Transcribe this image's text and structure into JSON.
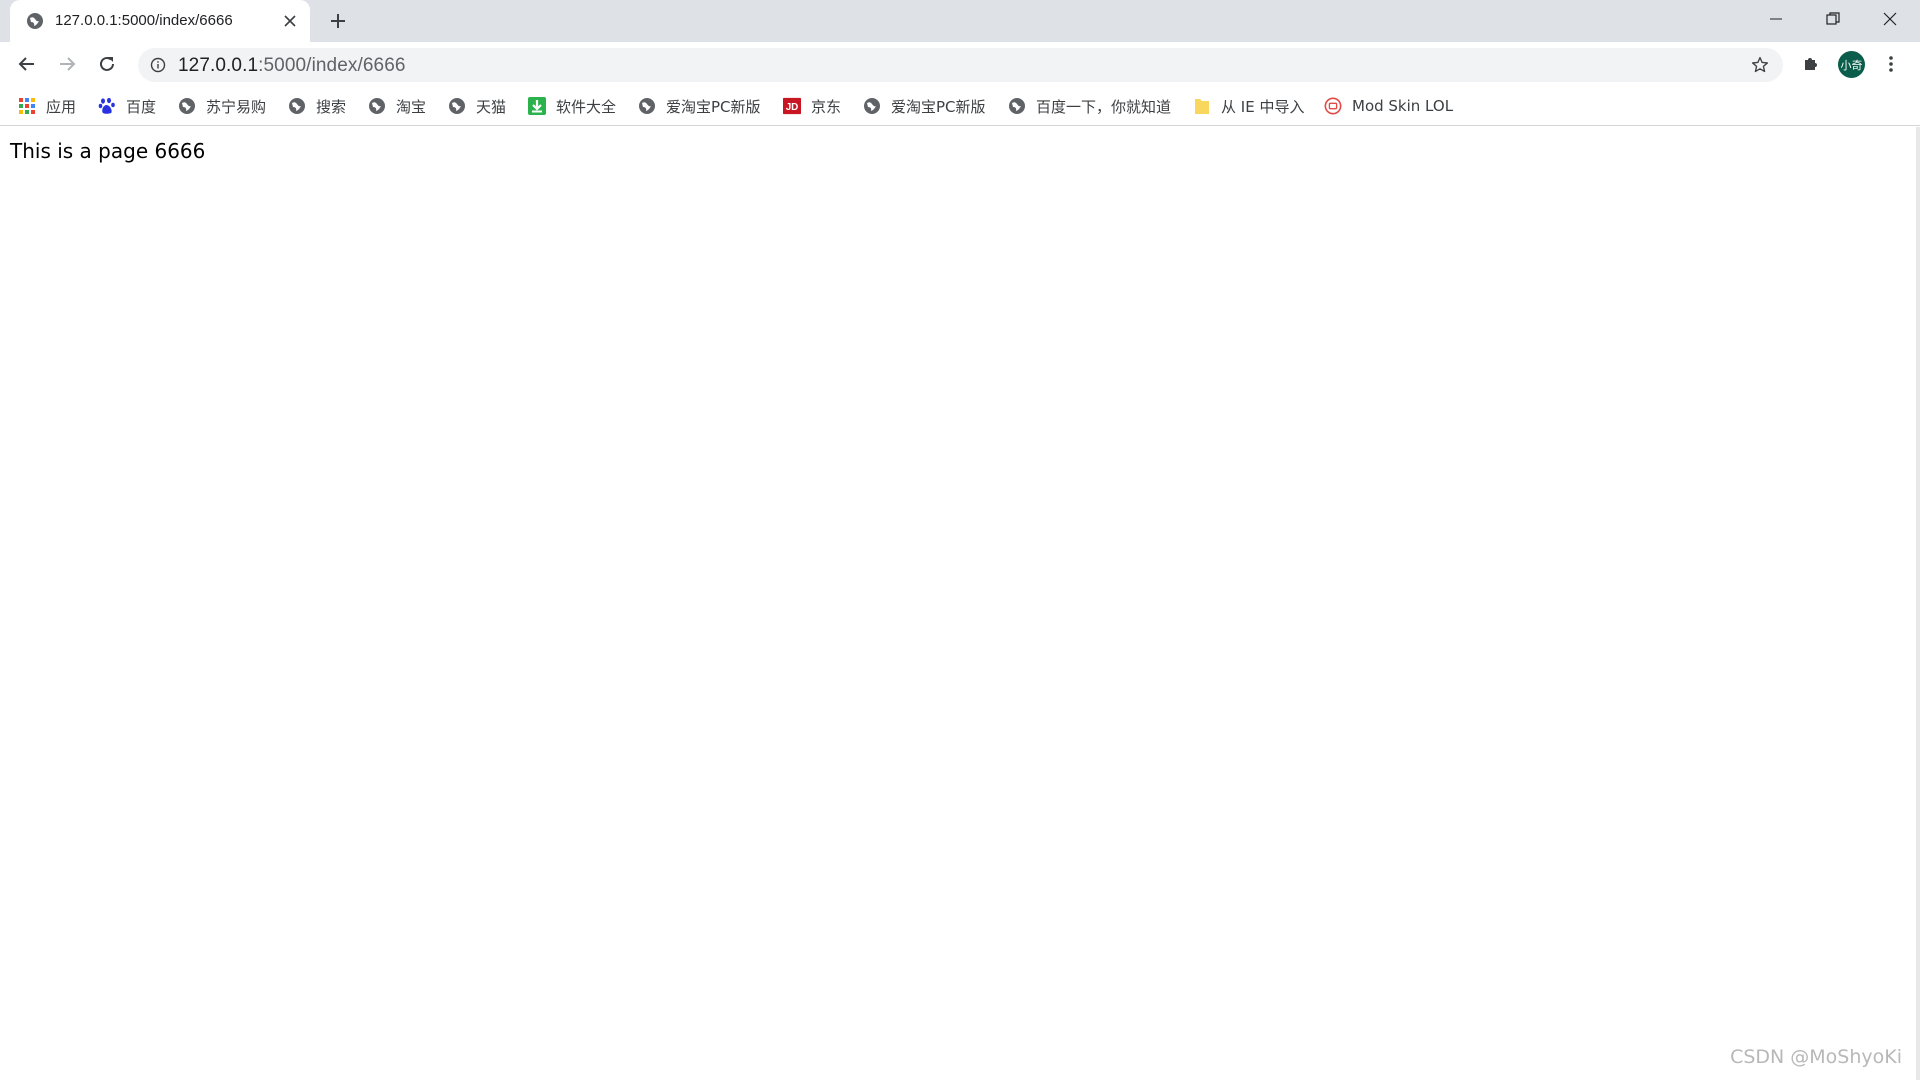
{
  "tab": {
    "title": "127.0.0.1:5000/index/6666",
    "favicon": "globe-icon"
  },
  "toolbar": {
    "url_host": "127.0.0.1",
    "url_path": ":5000/index/6666",
    "avatar_text": "小奇"
  },
  "bookmarks": [
    {
      "label": "应用",
      "icon": "apps-grid-icon"
    },
    {
      "label": "百度",
      "icon": "baidu-paw-icon"
    },
    {
      "label": "苏宁易购",
      "icon": "globe-icon"
    },
    {
      "label": "搜索",
      "icon": "globe-icon"
    },
    {
      "label": "淘宝",
      "icon": "globe-icon"
    },
    {
      "label": "天猫",
      "icon": "globe-icon"
    },
    {
      "label": "软件大全",
      "icon": "download-icon"
    },
    {
      "label": "爱淘宝PC新版",
      "icon": "globe-icon"
    },
    {
      "label": "京东",
      "icon": "jd-logo-icon"
    },
    {
      "label": "爱淘宝PC新版",
      "icon": "globe-icon"
    },
    {
      "label": "百度一下，你就知道",
      "icon": "globe-icon"
    },
    {
      "label": "从 IE 中导入",
      "icon": "folder-icon"
    },
    {
      "label": "Mod Skin LOL",
      "icon": "modskin-icon"
    }
  ],
  "page": {
    "text": "This is a page 6666"
  },
  "watermark": "CSDN @MoShyoKi",
  "colors": {
    "tabstrip": "#dee1e6",
    "omnibox": "#f1f3f4",
    "avatar": "#0b5d4b",
    "jd_red": "#c81623",
    "baidu_blue": "#2932e1",
    "download_green": "#2bb24c",
    "folder_yellow": "#f9d65c"
  }
}
